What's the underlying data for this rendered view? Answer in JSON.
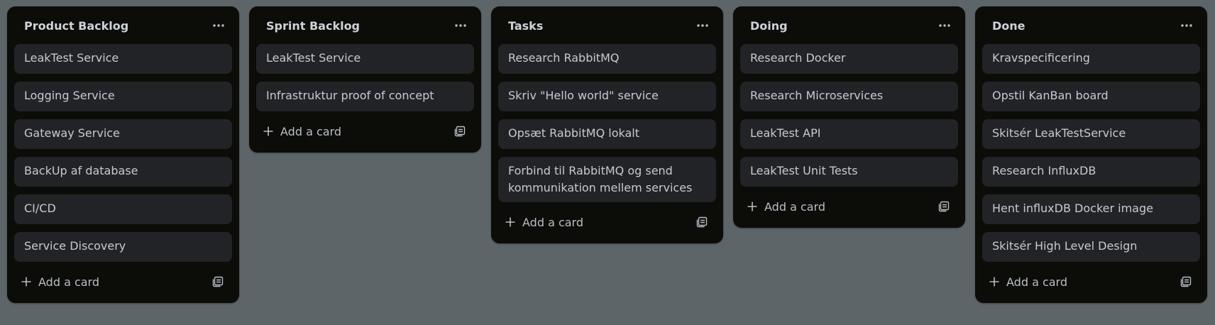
{
  "board": {
    "lists": [
      {
        "title": "Product Backlog",
        "cards": [
          "LeakTest Service",
          "Logging Service",
          "Gateway Service",
          "BackUp af database",
          "CI/CD",
          "Service Discovery"
        ],
        "add_label": "Add a card"
      },
      {
        "title": "Sprint Backlog",
        "cards": [
          "LeakTest Service",
          "Infrastruktur proof of concept"
        ],
        "add_label": "Add a card"
      },
      {
        "title": "Tasks",
        "cards": [
          "Research RabbitMQ",
          "Skriv \"Hello world\" service",
          "Opsæt RabbitMQ lokalt",
          "Forbind til RabbitMQ og send kommunikation mellem services"
        ],
        "add_label": "Add a card"
      },
      {
        "title": "Doing",
        "cards": [
          "Research Docker",
          "Research Microservices",
          "LeakTest API",
          "LeakTest Unit Tests"
        ],
        "add_label": "Add a card"
      },
      {
        "title": "Done",
        "cards": [
          "Kravspecificering",
          "Opstil KanBan board",
          "Skitsér LeakTestService",
          "Research InfluxDB",
          "Hent influxDB Docker image",
          "Skitsér High Level Design"
        ],
        "add_label": "Add a card"
      }
    ]
  },
  "icons": {
    "list_menu": "more-horizontal-icon",
    "add": "plus-icon",
    "template": "card-template-icon"
  },
  "colors": {
    "background": "#5d6568",
    "list_background": "#0c0c08",
    "card_background": "#222326",
    "text": "#c4cbd1"
  }
}
